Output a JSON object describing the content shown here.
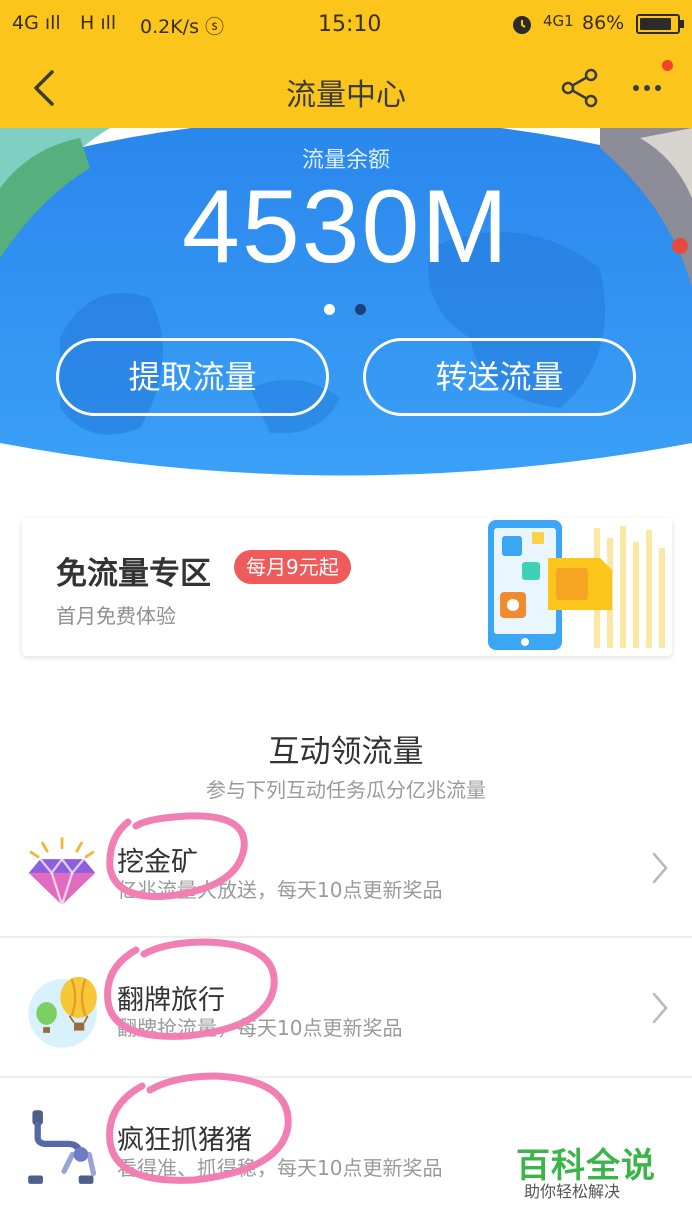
{
  "status_bar": {
    "signal_1": "4G ıll",
    "signal_2": "H ıll",
    "speed": "0.2K/s ⓢ",
    "time": "15:10",
    "alarm_icon": "alarm-icon",
    "network": "4G1",
    "battery": "86%",
    "battery_level": 0.86
  },
  "header": {
    "title": "流量中心",
    "back_icon": "chevron-left-icon",
    "share_icon": "share-icon",
    "more_icon": "more-icon"
  },
  "hero": {
    "label": "流量余额",
    "amount": "4530M",
    "page_indicator": {
      "count": 2,
      "active": 1
    },
    "buttons": [
      {
        "label": "提取流量"
      },
      {
        "label": "转送流量"
      }
    ]
  },
  "free_zone": {
    "title": "免流量专区",
    "badge": "每月9元起",
    "subtitle": "首月免费体验"
  },
  "interactive_section": {
    "title": "互动领流量",
    "subtitle": "参与下列互动任务瓜分亿兆流量"
  },
  "tasks": [
    {
      "name": "挖金矿",
      "desc": "亿兆流量大放送，每天10点更新奖品",
      "icon": "diamond-icon"
    },
    {
      "name": "翻牌旅行",
      "desc": "翻牌抢流量，每天10点更新奖品",
      "icon": "hot-air-balloon-icon"
    },
    {
      "name": "疯狂抓猪猪",
      "desc": "看得准、抓得稳，每天10点更新奖品",
      "icon": "claw-machine-icon"
    }
  ],
  "watermark": {
    "title": "百科全说",
    "subtitle": "助你轻松解决"
  },
  "colors": {
    "header_bg": "#fbc51c",
    "hero_blue": "#2f8ff0",
    "badge_red": "#ef5a5a",
    "annotation_pink": "#f27fb3",
    "watermark_green": "#3bb54a"
  }
}
